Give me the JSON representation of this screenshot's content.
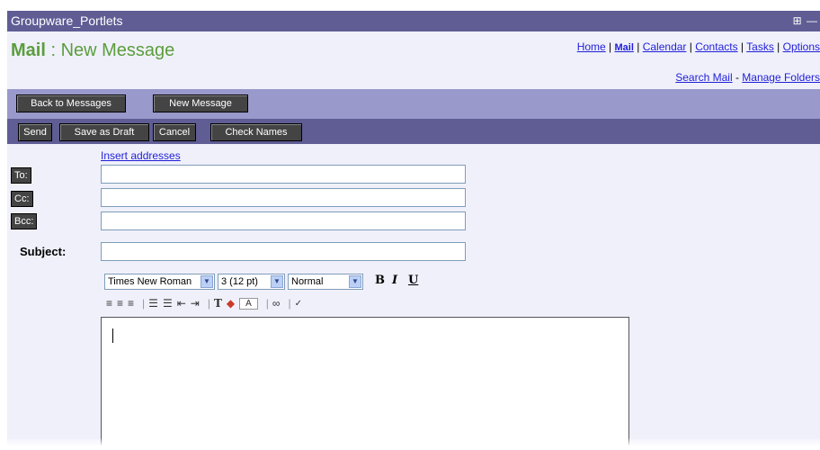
{
  "titlebar": {
    "title": "Groupware_Portlets",
    "controls": "⊞ —"
  },
  "header": {
    "app_name": "Mail",
    "separator": " : ",
    "page_title": "New Message",
    "nav": [
      "Home",
      "Mail",
      "Calendar",
      "Contacts",
      "Tasks",
      "Options"
    ],
    "subnav": {
      "search": "Search Mail",
      "dash": " - ",
      "manage": "Manage Folders"
    }
  },
  "toolbar_top": {
    "back": "Back to Messages",
    "new": "New Message"
  },
  "toolbar_actions": {
    "send": "Send",
    "draft": "Save as Draft",
    "cancel": "Cancel",
    "check": "Check Names"
  },
  "compose": {
    "insert_addresses": "Insert addresses",
    "to_label": "To:",
    "cc_label": "Cc:",
    "bcc_label": "Bcc:",
    "subject_label": "Subject:",
    "to_value": "",
    "cc_value": "",
    "bcc_value": "",
    "subject_value": ""
  },
  "editor_toolbar": {
    "font": "Times New Roman",
    "size": "3 (12 pt)",
    "style": "Normal",
    "bold": "B",
    "italic": "I",
    "underline": "U"
  },
  "colors": {
    "title_bar": "#5f5d94",
    "header_bg": "#f0f0fb",
    "brand_green": "#5a9e3c",
    "link": "#1f1fd8",
    "toolbar_light": "#9a99cc"
  }
}
